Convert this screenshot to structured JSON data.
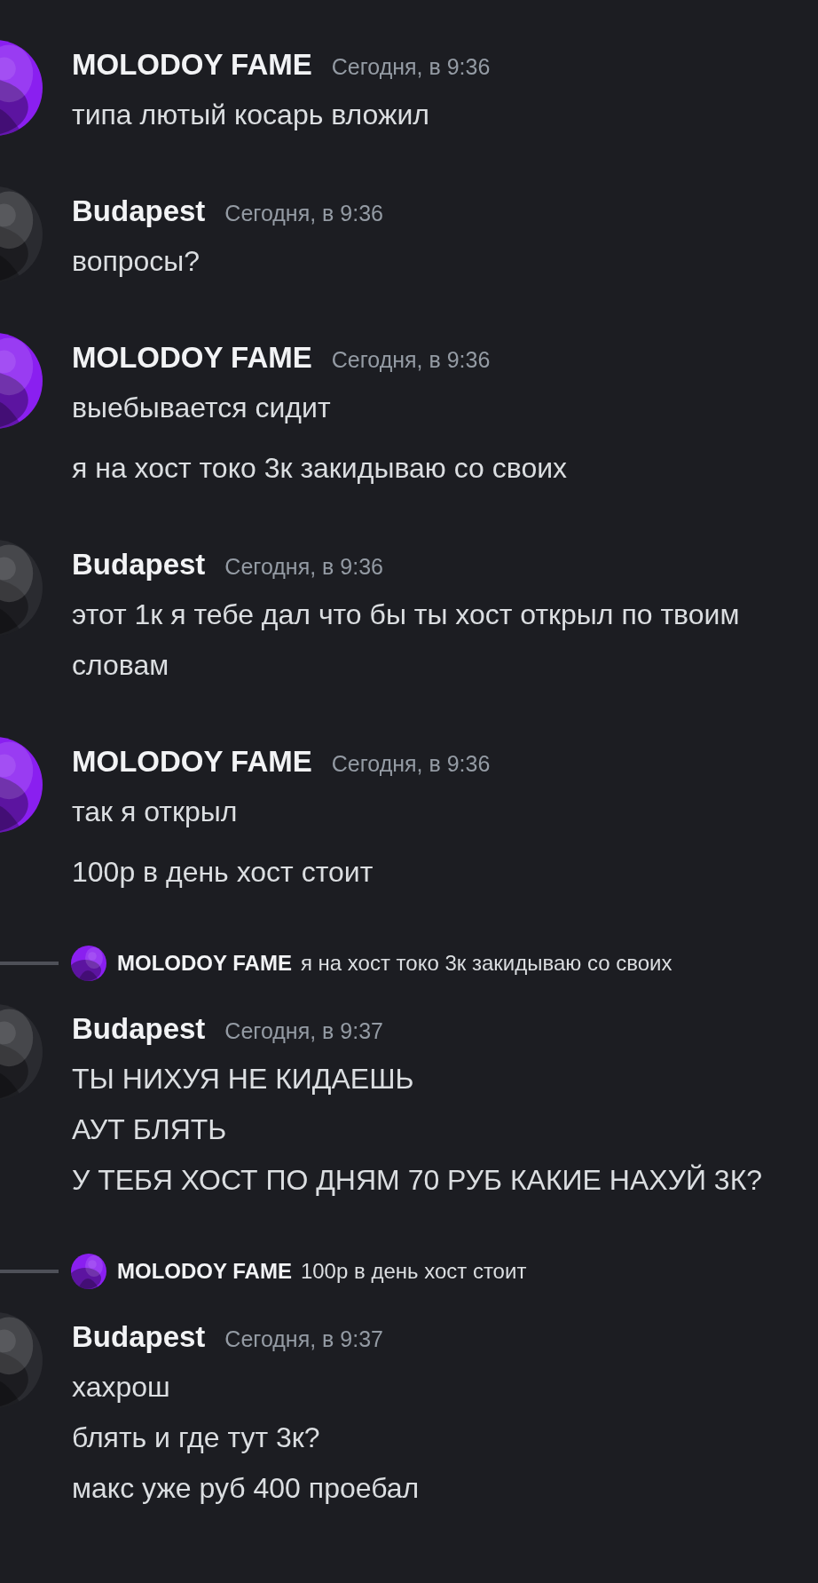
{
  "messages": [
    {
      "author": "MOLODOY FAME",
      "time": "Сегодня, в 9:36",
      "color": "#8a1ff0",
      "lines": [
        "типа лютый косарь вложил"
      ]
    },
    {
      "author": "Budapest",
      "time": "Сегодня, в 9:36",
      "color": "#2a2b30",
      "lines": [
        "вопросы?"
      ]
    },
    {
      "author": "MOLODOY FAME",
      "time": "Сегодня, в 9:36",
      "color": "#8a1ff0",
      "lines": [
        "выебывается сидит",
        "я на хост токо 3к закидываю со своих"
      ]
    },
    {
      "author": "Budapest",
      "time": "Сегодня, в 9:36",
      "color": "#2a2b30",
      "lines": [
        "этот 1к я тебе дал что бы ты хост открыл по твоим словам"
      ]
    },
    {
      "author": "MOLODOY FAME",
      "time": "Сегодня, в 9:36",
      "color": "#8a1ff0",
      "lines": [
        "так я открыл",
        "100р в день хост стоит"
      ]
    },
    {
      "reply": {
        "author": "MOLODOY FAME",
        "color": "#8a1ff0",
        "text": "я на хост токо 3к закидываю со своих"
      },
      "author": "Budapest",
      "time": "Сегодня, в 9:37",
      "color": "#2a2b30",
      "lines": [
        "ТЫ НИХУЯ НЕ КИДАЕШЬ\nАУТ БЛЯТЬ\nУ ТЕБЯ ХОСТ ПО ДНЯМ 70 РУБ КАКИЕ НАХУЙ 3К?"
      ]
    },
    {
      "reply": {
        "author": "MOLODOY FAME",
        "color": "#8a1ff0",
        "text": "100р в день хост стоит"
      },
      "author": "Budapest",
      "time": "Сегодня, в 9:37",
      "color": "#2a2b30",
      "lines": [
        "хахрош\nблять и где тут 3к?\nмакс уже руб 400 проебал"
      ]
    }
  ]
}
